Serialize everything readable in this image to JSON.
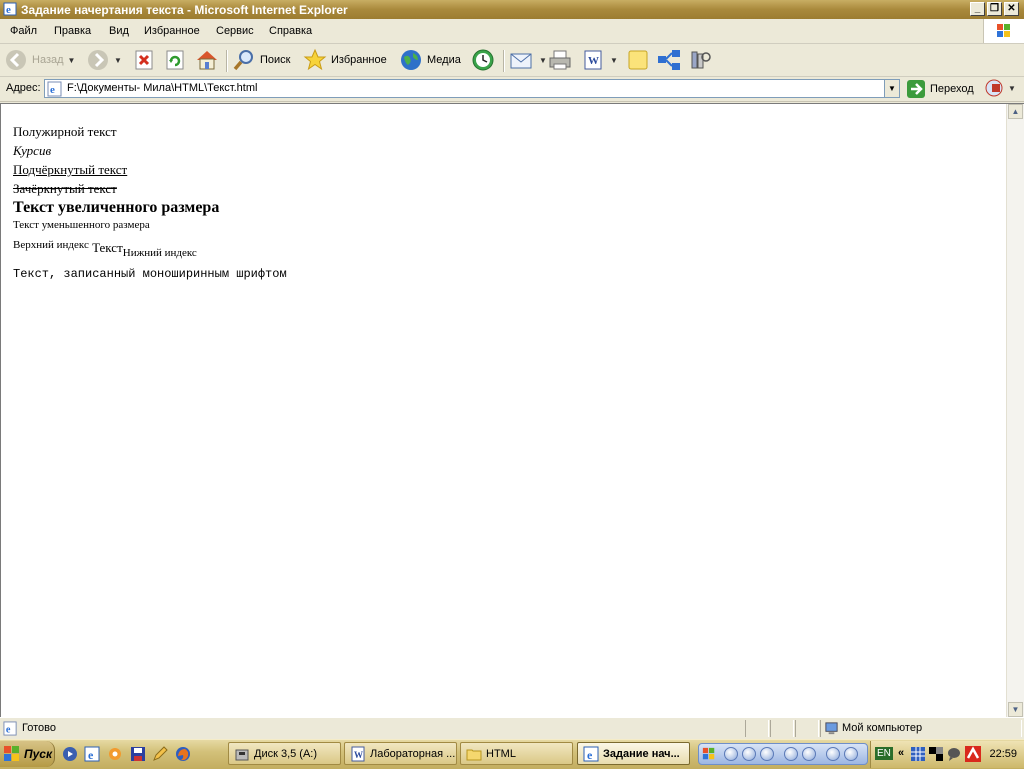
{
  "window": {
    "title": "Задание начертания текста - Microsoft Internet Explorer",
    "buttons": {
      "minimize": "_",
      "maximize": "❐",
      "close": "✕"
    }
  },
  "menu": {
    "items": [
      "Файл",
      "Правка",
      "Вид",
      "Избранное",
      "Сервис",
      "Справка"
    ]
  },
  "toolbar": {
    "back": "Назад",
    "search": "Поиск",
    "favorites": "Избранное",
    "media": "Медиа"
  },
  "address": {
    "label": "Адрес:",
    "url": "F:\\Документы- Мила\\HTML\\Текст.html",
    "go": "Переход"
  },
  "page": {
    "lines": {
      "bold": "Полужирной текст",
      "italic": "Курсив",
      "underline": "Подчёркнутый текст",
      "strike": "Зачёркнутый текст",
      "big": "Текст увеличенного размера",
      "small": "Текст уменьшенного размера",
      "sup": "Верхний индекс",
      "normal": "Текст",
      "sub": "Нижний индекс",
      "mono": "Текст, записанный моноширинным шрифтом"
    }
  },
  "status": {
    "text": "Готово",
    "zone": "Мой компьютер"
  },
  "taskbar": {
    "start": "Пуск",
    "tasks": [
      "Диск 3,5 (A:)",
      "Лабораторная ...",
      "HTML",
      "Задание нач..."
    ],
    "tray": {
      "lang": "EN",
      "clock": "22:59",
      "chevron": "«"
    }
  },
  "colors": {
    "titlebar": "#a9893c",
    "chrome": "#ece9d8",
    "page_bg": "#ffffff"
  }
}
